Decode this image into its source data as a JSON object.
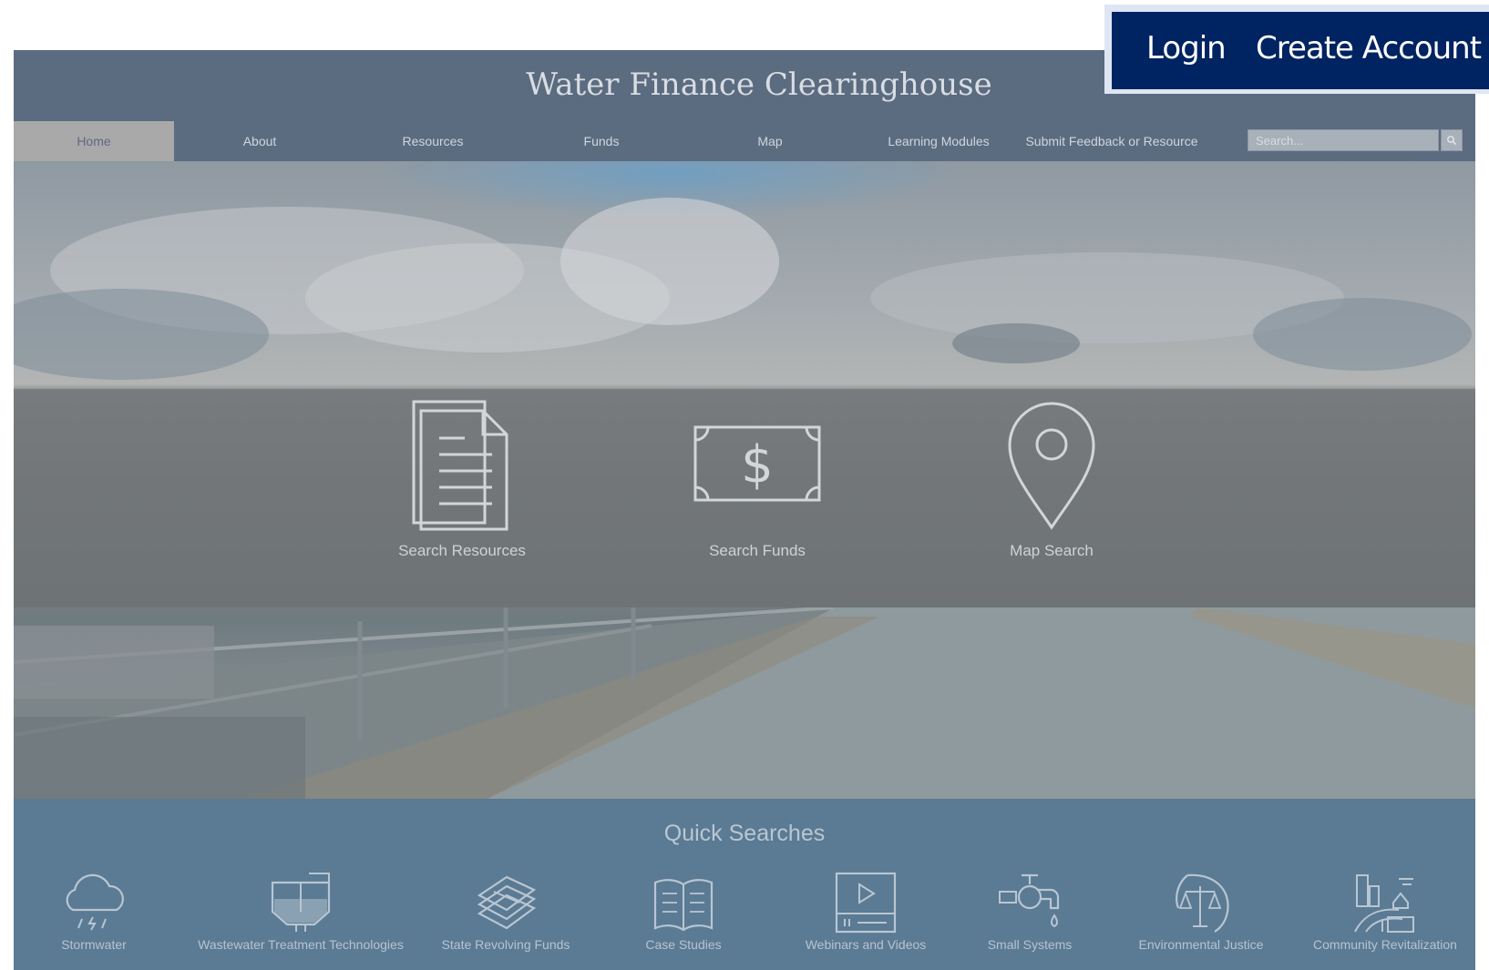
{
  "site": {
    "title": "Water Finance Clearinghouse"
  },
  "nav": {
    "items": [
      {
        "label": "Home",
        "active": true
      },
      {
        "label": "About"
      },
      {
        "label": "Resources"
      },
      {
        "label": "Funds"
      },
      {
        "label": "Map"
      },
      {
        "label": "Learning Modules"
      },
      {
        "label": "Submit Feedback or Resource"
      }
    ],
    "search_placeholder": "Search..."
  },
  "hero": {
    "links": [
      {
        "label": "Search Resources",
        "icon": "document-icon"
      },
      {
        "label": "Search Funds",
        "icon": "dollar-bill-icon"
      },
      {
        "label": "Map Search",
        "icon": "map-pin-icon"
      }
    ]
  },
  "quick": {
    "title": "Quick Searches",
    "items": [
      {
        "label": "Stormwater",
        "icon": "storm-cloud-icon"
      },
      {
        "label": "Wastewater Treatment Technologies",
        "icon": "treatment-tank-icon"
      },
      {
        "label": "State Revolving Funds",
        "icon": "money-stack-icon"
      },
      {
        "label": "Case Studies",
        "icon": "open-book-icon"
      },
      {
        "label": "Webinars and Videos",
        "icon": "video-player-icon"
      },
      {
        "label": "Small Systems",
        "icon": "faucet-icon"
      },
      {
        "label": "Environmental Justice",
        "icon": "scales-icon"
      },
      {
        "label": "Community Revitalization",
        "icon": "community-icon"
      }
    ]
  },
  "account": {
    "login": "Login",
    "create": "Create Account"
  },
  "colors": {
    "header": "#5b6b80",
    "quick_bg": "#5b7a93",
    "account_bg": "#002361"
  }
}
